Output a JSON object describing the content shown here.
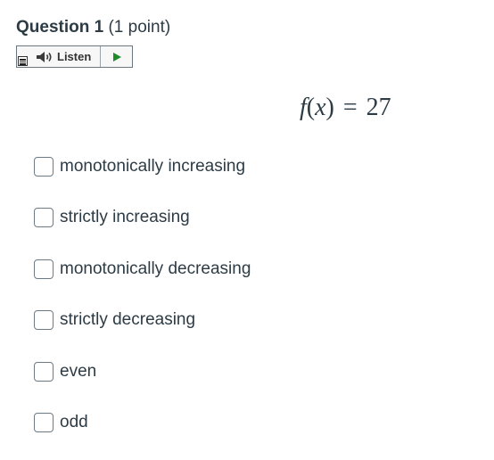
{
  "question": {
    "label": "Question 1",
    "points": "(1 point)"
  },
  "listen": {
    "label": "Listen",
    "menu_icon": "menu-icon",
    "speaker_icon": "speaker-icon",
    "play_icon": "play-icon",
    "play_color": "#1f8a2a"
  },
  "expression": {
    "func": "f",
    "open": "(",
    "var": "x",
    "close": ")",
    "equals": "=",
    "value": "27"
  },
  "options": [
    {
      "label": "monotonically increasing",
      "checked": false
    },
    {
      "label": "strictly increasing",
      "checked": false
    },
    {
      "label": "monotonically decreasing",
      "checked": false
    },
    {
      "label": "strictly decreasing",
      "checked": false
    },
    {
      "label": "even",
      "checked": false
    },
    {
      "label": "odd",
      "checked": false
    }
  ]
}
